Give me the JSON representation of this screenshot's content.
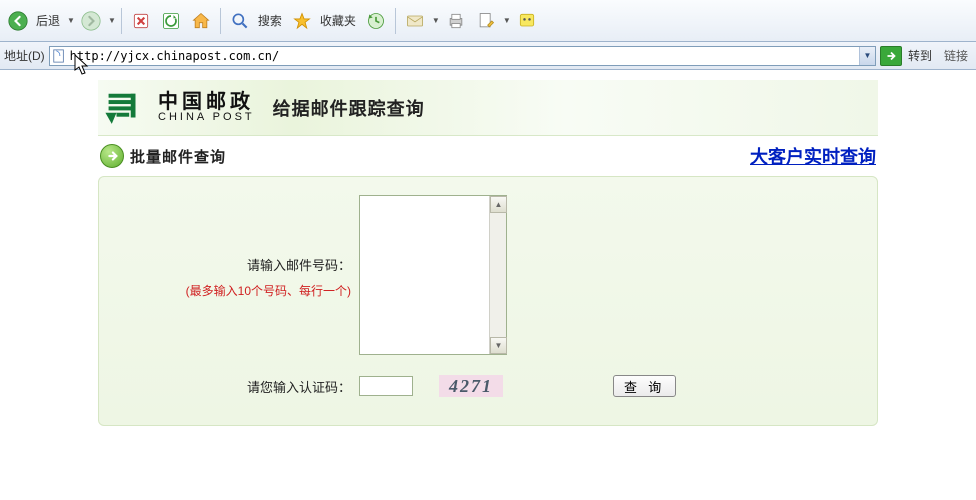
{
  "toolbar": {
    "back_label": "后退",
    "search_label": "搜索",
    "favorites_label": "收藏夹"
  },
  "addressbar": {
    "label": "地址(D)",
    "url": "http://yjcx.chinapost.com.cn/",
    "go_label": "转到",
    "links_label": "链接"
  },
  "logo": {
    "cn": "中国邮政",
    "en": "CHINA POST"
  },
  "page_title": "给据邮件跟踪查询",
  "subhead": {
    "bulk_label": "批量邮件查询",
    "big_link": "大客户实时查询"
  },
  "form": {
    "mail_label": "请输入邮件号码：",
    "mail_hint": "(最多输入10个号码、每行一个)",
    "captcha_label": "请您输入认证码：",
    "captcha_value": "4271",
    "query_button": "查 询"
  }
}
